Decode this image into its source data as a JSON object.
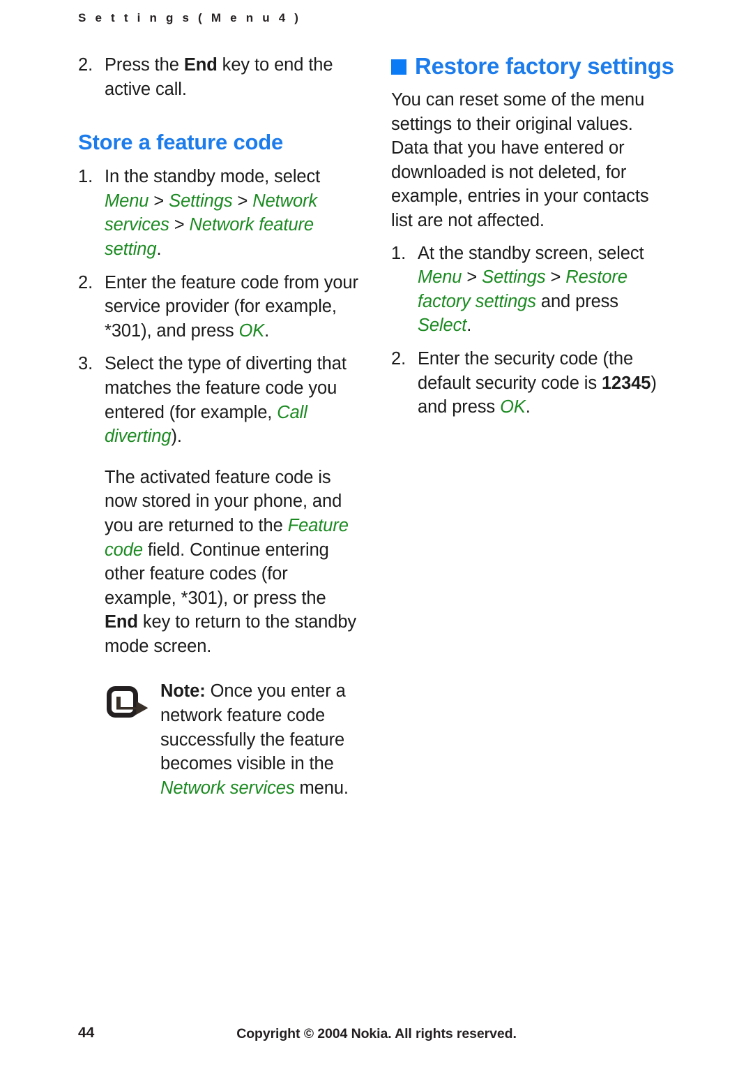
{
  "header": {
    "running_title": "S e t t i n g s   ( M e n u   4 )"
  },
  "colors": {
    "heading_blue": "#1c7ceb",
    "bullet_blue": "#0b7bf5",
    "menu_green": "#1a8a20",
    "body_black": "#1b1b1b"
  },
  "left_column": {
    "continued_step": {
      "number": "2.",
      "text_before": "Press the ",
      "key_bold": "End",
      "text_after": " key to end the active call."
    },
    "section_heading": "Store a feature code",
    "steps": [
      {
        "number": "1.",
        "lead": "In the standby mode, select ",
        "path": [
          "Menu",
          "Settings",
          "Network services",
          "Network feature setting"
        ],
        "separator": " > ",
        "trailing": "."
      },
      {
        "number": "2.",
        "lead": "Enter the feature code from your service provider (for example, *301), and press ",
        "emphasis": "OK",
        "trailing": "."
      },
      {
        "number": "3.",
        "lead": "Select the type of diverting that matches the feature code you entered (for example, ",
        "emphasis": "Call diverting",
        "trailing": ")."
      }
    ],
    "step3_paragraph": {
      "part1": "The activated feature code is now stored in your phone, and you are returned to the ",
      "emphasis1": "Feature code",
      "part2": " field. Continue entering other feature codes (for example, *301), or press the ",
      "bold1": "End",
      "part3": " key to return to the standby mode screen."
    },
    "note": {
      "icon": "note-arrow-icon",
      "label": "Note:",
      "part1": " Once you enter a network feature code successfully the feature becomes visible in the ",
      "emphasis1": "Network services",
      "part2": " menu."
    }
  },
  "right_column": {
    "section_bullet": "square-bullet-icon",
    "section_heading": "Restore factory settings",
    "intro": "You can reset some of the menu settings to their original values. Data that you have entered or downloaded is not deleted, for example, entries in your contacts list are not affected.",
    "steps": [
      {
        "number": "1.",
        "lead": "At the standby screen, select ",
        "path": [
          "Menu",
          "Settings",
          "Restore factory settings"
        ],
        "separator": " > ",
        "mid": " and press ",
        "emphasis": "Select",
        "trailing": "."
      },
      {
        "number": "2.",
        "lead": "Enter the security code (the default security code is ",
        "bold": "12345",
        "mid": ") and press ",
        "emphasis": "OK",
        "trailing": "."
      }
    ]
  },
  "footer": {
    "page_number": "44",
    "copyright": "Copyright © 2004 Nokia. All rights reserved."
  }
}
